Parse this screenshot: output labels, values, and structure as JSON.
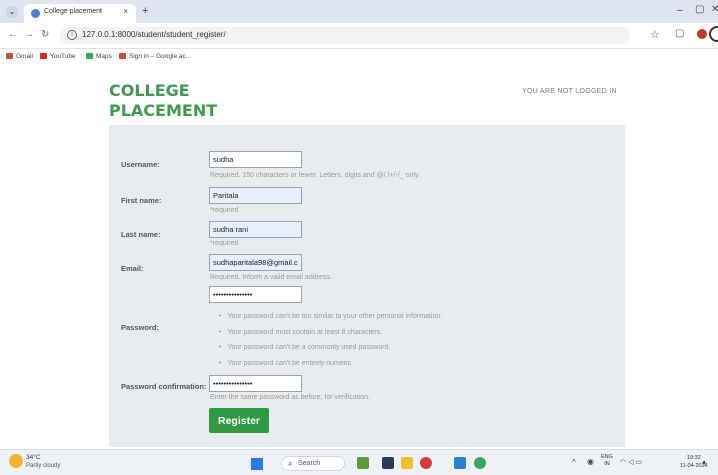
{
  "browser": {
    "tab_title": "College placement",
    "tab_close": "×",
    "new_tab": "+",
    "url": "127.0.0.1:8000/student/student_register/",
    "bookmarks": [
      "Gmail",
      "YouTube",
      "Maps",
      "Sign in – Google ac..."
    ],
    "window_controls": [
      "–",
      "▢",
      "✕"
    ]
  },
  "site": {
    "brand_line1": "COLLEGE",
    "brand_line2": "PLACEMENT",
    "login_status": "YOU ARE NOT LOGGED IN"
  },
  "form": {
    "username": {
      "label": "Username:",
      "value": "sudha",
      "help": "Required. 150 characters or fewer. Letters, digits and @/./+/-/_ only."
    },
    "first_name": {
      "label": "First name:",
      "value": "Paritala",
      "help": "*required"
    },
    "last_name": {
      "label": "Last name:",
      "value": "sudha rani",
      "help": "*required"
    },
    "email": {
      "label": "Email:",
      "value": "sudhaparitala98@gmail.c",
      "help": "Required. Inform a valid email address."
    },
    "password": {
      "label": "Password:",
      "value": "•••••••••••••••",
      "rules": [
        "Your password can't be too similar to your other personal information.",
        "Your password must contain at least 8 characters.",
        "Your password can't be a commonly used password.",
        "Your password can't be entirely numeric."
      ]
    },
    "password_confirmation": {
      "label": "Password confirmation:",
      "value": "•••••••••••••••",
      "help": "Enter the same password as before, for verification."
    },
    "submit_label": "Register"
  },
  "taskbar": {
    "weather_temp": "34°C",
    "weather_desc": "Partly cloudy",
    "search_label": "Search",
    "lang": "ENG",
    "region": "IN",
    "time": "19:32",
    "date": "11-04-2024"
  },
  "colors": {
    "brand_green": "#3f9a50",
    "button_green": "#2e9a43",
    "panel_bg": "#e9ecee"
  }
}
